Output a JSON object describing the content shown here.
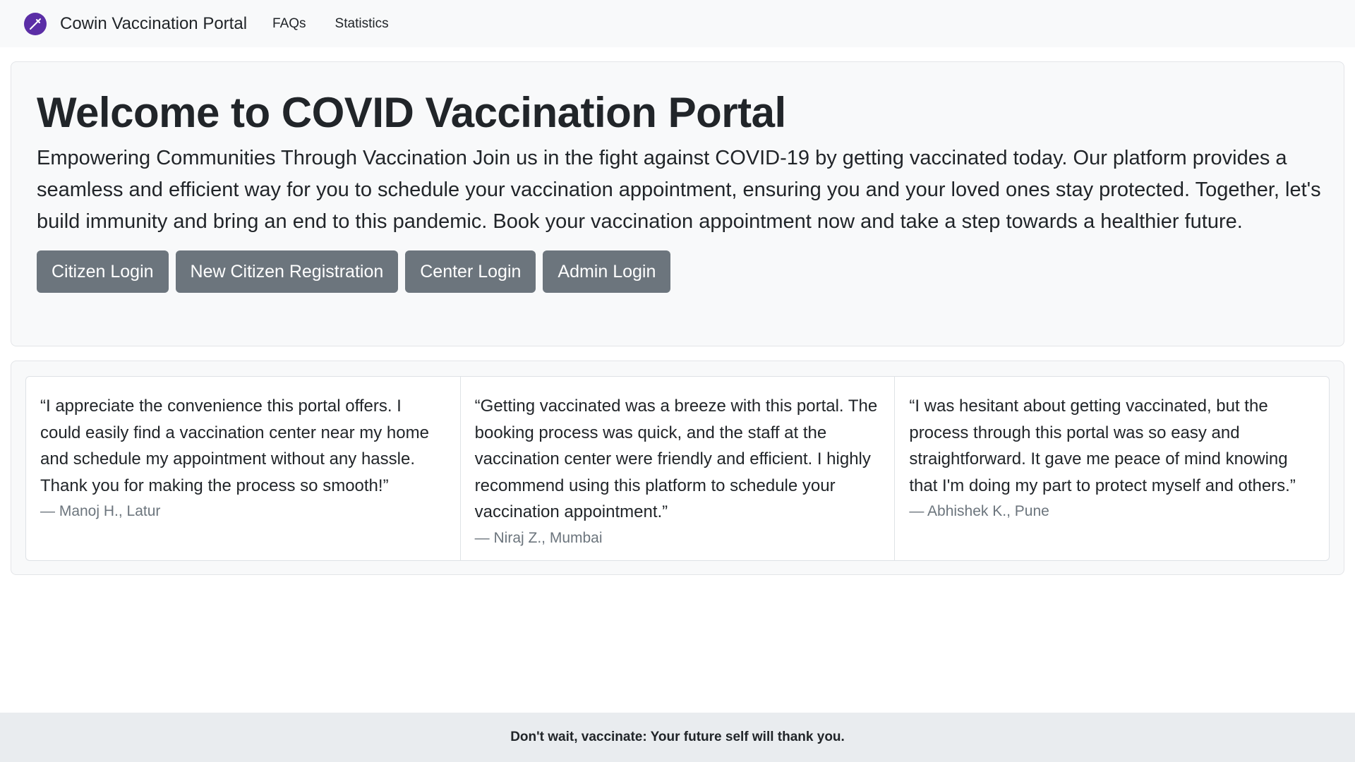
{
  "navbar": {
    "brand": "Cowin Vaccination Portal",
    "logo_icon": "syringe-icon",
    "logo_color": "#5b2ea6",
    "links": [
      "FAQs",
      "Statistics"
    ]
  },
  "hero": {
    "title": "Welcome to COVID Vaccination Portal",
    "text": "Empowering Communities Through Vaccination Join us in the fight against COVID-19 by getting vaccinated today. Our platform provides a seamless and efficient way for you to schedule your vaccination appointment, ensuring you and your loved ones stay protected. Together, let's build immunity and bring an end to this pandemic. Book your vaccination appointment now and take a step towards a healthier future.",
    "buttons": [
      "Citizen Login",
      "New Citizen Registration",
      "Center Login",
      "Admin Login"
    ],
    "button_color": "#6c757d"
  },
  "testimonials": [
    {
      "quote": "“I appreciate the convenience this portal offers. I could easily find a vaccination center near my home and schedule my appointment without any hassle. Thank you for making the process so smooth!”",
      "author": "— Manoj H., Latur"
    },
    {
      "quote": "“Getting vaccinated was a breeze with this portal. The booking process was quick, and the staff at the vaccination center were friendly and efficient. I highly recommend using this platform to schedule your vaccination appointment.”",
      "author": "— Niraj Z., Mumbai"
    },
    {
      "quote": "“I was hesitant about getting vaccinated, but the process through this portal was so easy and straightforward. It gave me peace of mind knowing that I'm doing my part to protect myself and others.”",
      "author": "— Abhishek K., Pune"
    }
  ],
  "footer": {
    "text": "Don't wait, vaccinate: Your future self will thank you."
  }
}
